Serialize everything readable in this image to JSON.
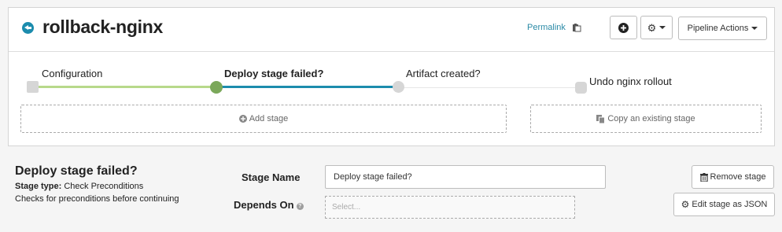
{
  "header": {
    "title": "rollback-nginx",
    "permalink_label": "Permalink",
    "pipeline_actions_label": "Pipeline Actions"
  },
  "graph": {
    "stages": [
      {
        "label": "Configuration",
        "bold": false
      },
      {
        "label": "Deploy stage failed?",
        "bold": true
      },
      {
        "label": "Artifact created?",
        "bold": false
      },
      {
        "label": "Undo nginx rollout",
        "bold": false
      }
    ],
    "add_stage_label": "Add stage",
    "copy_stage_label": "Copy an existing stage"
  },
  "detail": {
    "title": "Deploy stage failed?",
    "stage_type_prefix": "Stage type:",
    "stage_type_value": "Check Preconditions",
    "description": "Checks for preconditions before continuing",
    "stage_name_label": "Stage Name",
    "stage_name_value": "Deploy stage failed?",
    "depends_on_label": "Depends On",
    "depends_on_placeholder": "Select...",
    "remove_stage_label": "Remove stage",
    "edit_json_label": "Edit stage as JSON"
  },
  "colors": {
    "accent": "#1c8cad",
    "config_line": "#b7d98a",
    "active_node": "#7ba85a",
    "active_line": "#1c8cad",
    "inactive_node": "#d6d6d6"
  }
}
